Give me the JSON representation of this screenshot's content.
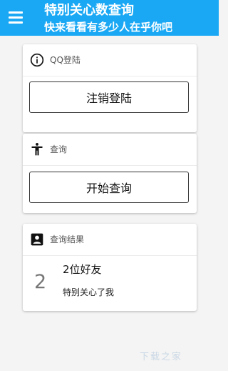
{
  "header": {
    "title": "特别关心数查询",
    "subtitle": "快来看看有多少人在乎你吧",
    "accent_color": "#1aa8f4"
  },
  "cards": {
    "login": {
      "label": "QQ登陆",
      "icon": "info-icon",
      "button_label": "注销登陆"
    },
    "query": {
      "label": "查询",
      "icon": "person-standing-icon",
      "button_label": "开始查询"
    },
    "result": {
      "label": "查询结果",
      "icon": "contact-box-icon",
      "count": "2",
      "title": "2位好友",
      "description": "特别关心了我"
    }
  },
  "watermark": "下载之家"
}
